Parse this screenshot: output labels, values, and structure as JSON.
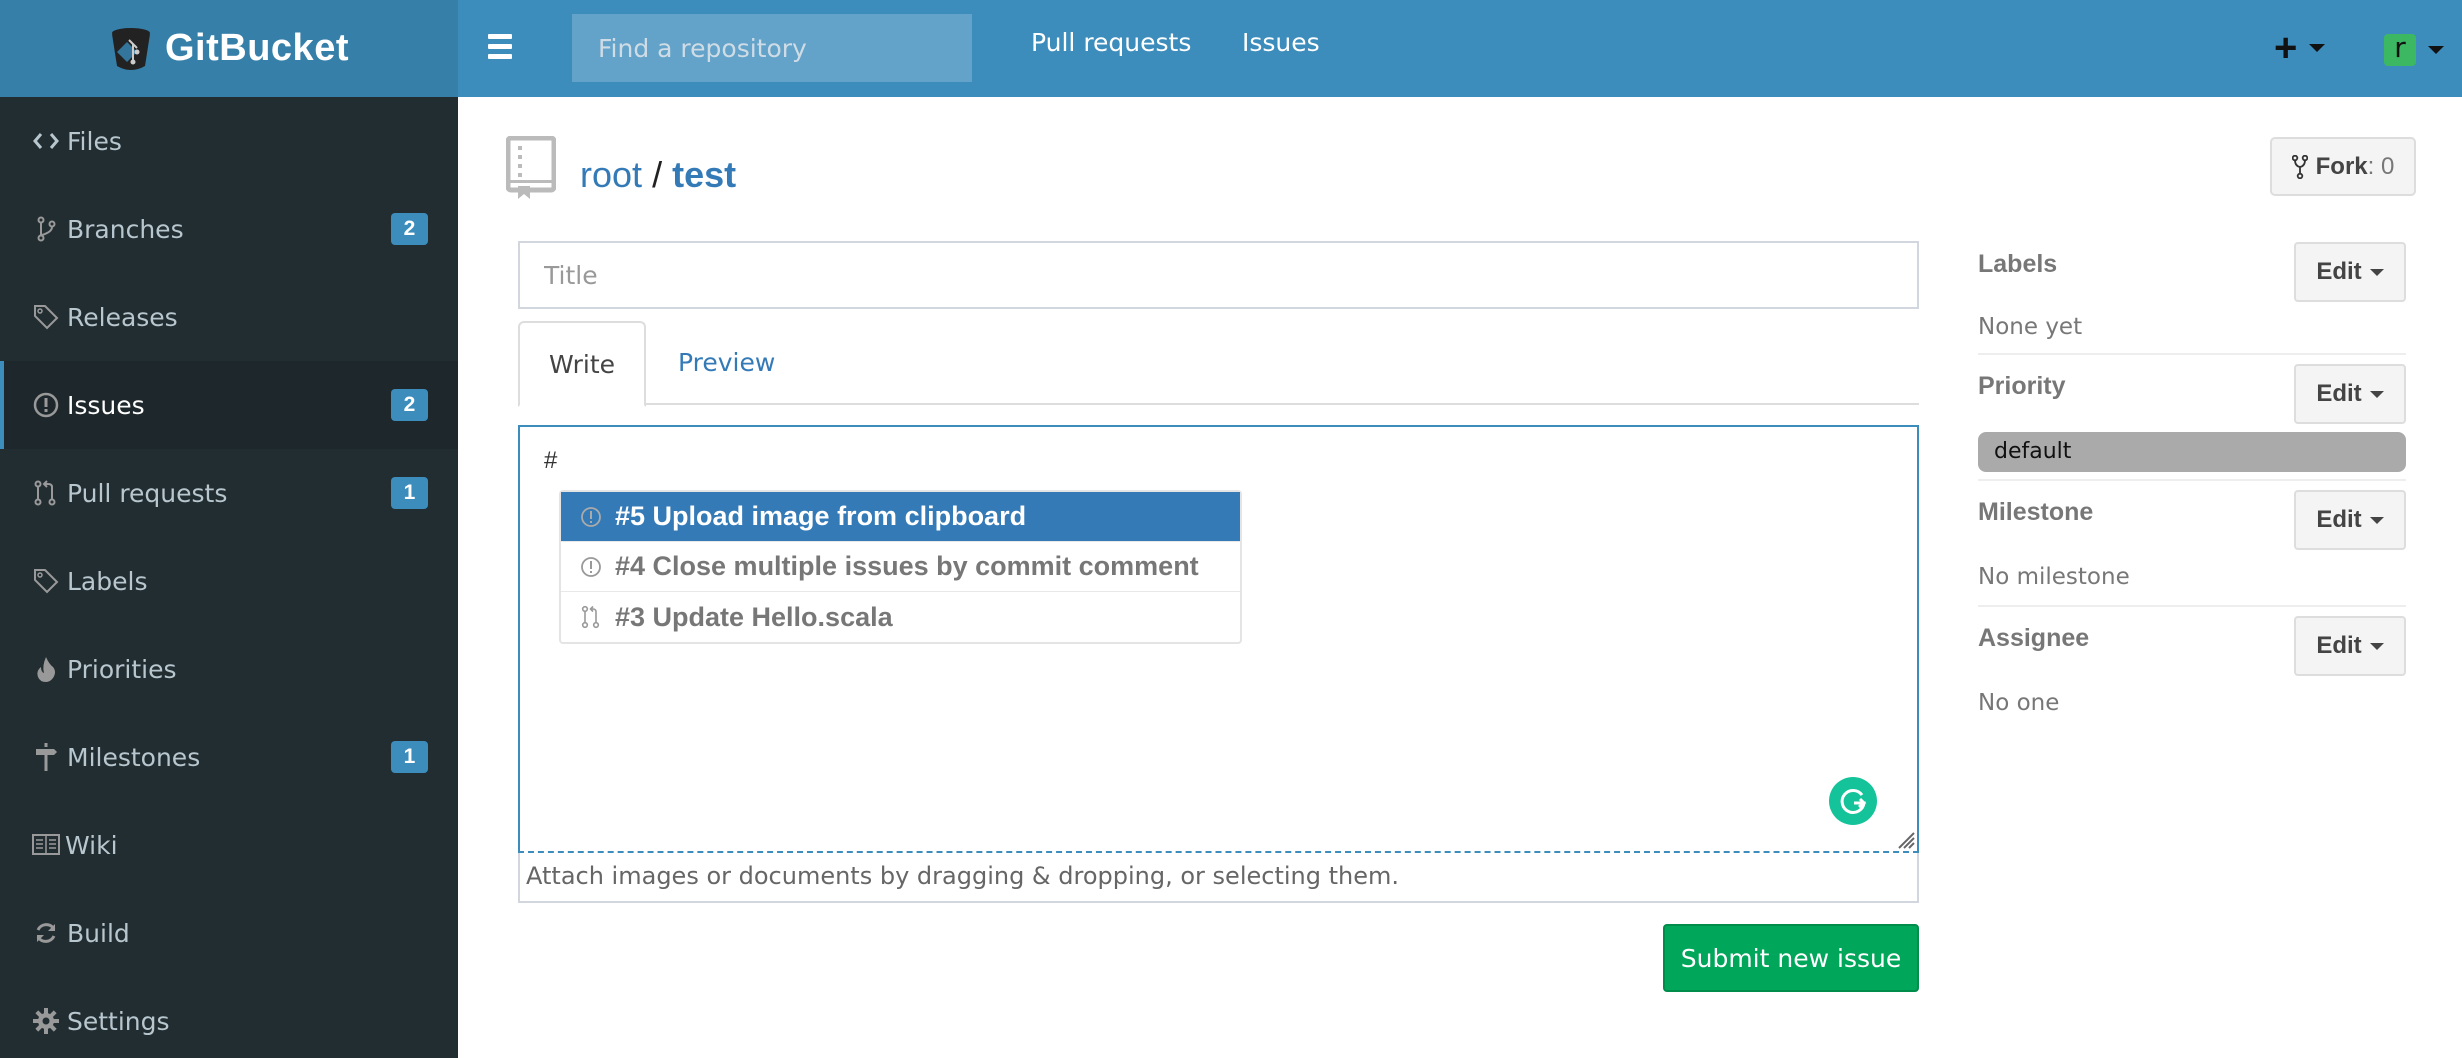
{
  "header": {
    "brand": "GitBucket",
    "search_placeholder": "Find a repository",
    "nav": [
      "Pull requests",
      "Issues"
    ],
    "user_initial": "r",
    "colors": {
      "header": "#3c8dbc",
      "brand_bg": "#367fa9",
      "avatar": "#3cb862"
    }
  },
  "sidebar": {
    "items": [
      {
        "label": "Files",
        "icon": "code-icon",
        "badge": null
      },
      {
        "label": "Branches",
        "icon": "branch-icon",
        "badge": "2"
      },
      {
        "label": "Releases",
        "icon": "tag-icon",
        "badge": null
      },
      {
        "label": "Issues",
        "icon": "issue-opened-icon",
        "badge": "2",
        "active": true
      },
      {
        "label": "Pull requests",
        "icon": "pull-request-icon",
        "badge": "1"
      },
      {
        "label": "Labels",
        "icon": "tag-icon",
        "badge": null
      },
      {
        "label": "Priorities",
        "icon": "flame-icon",
        "badge": null
      },
      {
        "label": "Milestones",
        "icon": "milestone-icon",
        "badge": "1"
      },
      {
        "label": "Wiki",
        "icon": "book-icon",
        "badge": null
      },
      {
        "label": "Build",
        "icon": "sync-icon",
        "badge": null
      },
      {
        "label": "Settings",
        "icon": "gear-icon",
        "badge": null
      }
    ]
  },
  "repo": {
    "owner": "root",
    "separator": "/",
    "name": "test",
    "fork_label": "Fork",
    "fork_count": ": 0"
  },
  "form": {
    "title_placeholder": "Title",
    "title_value": "",
    "tabs": [
      "Write",
      "Preview"
    ],
    "editor_value": "#",
    "suggestions": [
      {
        "text": "#5 Upload image from clipboard",
        "type": "issue",
        "selected": true
      },
      {
        "text": "#4 Close multiple issues by commit comment",
        "type": "issue",
        "selected": false
      },
      {
        "text": "#3 Update Hello.scala",
        "type": "pull-request",
        "selected": false
      }
    ],
    "attach_hint": "Attach images or documents by dragging & dropping, or selecting them.",
    "submit_label": "Submit new issue"
  },
  "meta": {
    "edit_label": "Edit",
    "labels": {
      "title": "Labels",
      "value": "None yet"
    },
    "priority": {
      "title": "Priority",
      "value": "default"
    },
    "milestone": {
      "title": "Milestone",
      "value": "No milestone"
    },
    "assignee": {
      "title": "Assignee",
      "value": "No one"
    }
  }
}
